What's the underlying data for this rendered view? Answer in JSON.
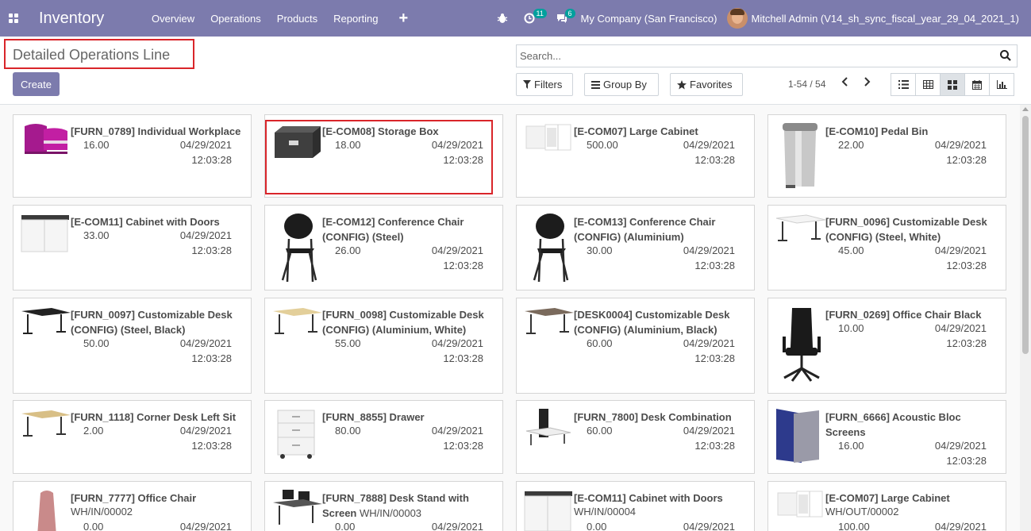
{
  "navbar": {
    "app_title": "Inventory",
    "menu": [
      "Overview",
      "Operations",
      "Products",
      "Reporting"
    ],
    "plus": "+",
    "activity_badge": "11",
    "messages_badge": "6",
    "company": "My Company (San Francisco)",
    "user": "Mitchell Admin (V14_sh_sync_fiscal_year_29_04_2021_1)",
    "bg_color": "#7c7bad"
  },
  "control": {
    "page_title": "Detailed Operations Line",
    "create_label": "Create",
    "search_placeholder": "Search...",
    "filters_label": "Filters",
    "groupby_label": "Group By",
    "favorites_label": "Favorites",
    "pager": "1-54 / 54",
    "active_view": "kanban"
  },
  "cards": [
    {
      "name": "[FURN_0789] Individual Workplace",
      "ref": "",
      "qty": "16.00",
      "date": "04/29/2021",
      "time": "12:03:28",
      "icon": "workplace-image"
    },
    {
      "name": "[E-COM08] Storage Box",
      "ref": "",
      "qty": "18.00",
      "date": "04/29/2021",
      "time": "12:03:28",
      "icon": "storage-box-image"
    },
    {
      "name": "[E-COM07] Large Cabinet",
      "ref": "",
      "qty": "500.00",
      "date": "04/29/2021",
      "time": "12:03:28",
      "icon": "cabinet-image"
    },
    {
      "name": "[E-COM10] Pedal Bin",
      "ref": "",
      "qty": "22.00",
      "date": "04/29/2021",
      "time": "12:03:28",
      "icon": "pedal-bin-image"
    },
    {
      "name": "[E-COM11] Cabinet with Doors",
      "ref": "",
      "qty": "33.00",
      "date": "04/29/2021",
      "time": "12:03:28",
      "icon": "cabinet-doors-image"
    },
    {
      "name": "[E-COM12] Conference Chair (CONFIG) (Steel)",
      "ref": "",
      "qty": "26.00",
      "date": "04/29/2021",
      "time": "12:03:28",
      "icon": "chair-image"
    },
    {
      "name": "[E-COM13] Conference Chair (CONFIG) (Aluminium)",
      "ref": "",
      "qty": "30.00",
      "date": "04/29/2021",
      "time": "12:03:28",
      "icon": "chair-image"
    },
    {
      "name": "[FURN_0096] Customizable Desk (CONFIG) (Steel, White)",
      "ref": "",
      "qty": "45.00",
      "date": "04/29/2021",
      "time": "12:03:28",
      "icon": "desk-white-image"
    },
    {
      "name": "[FURN_0097] Customizable Desk (CONFIG) (Steel, Black)",
      "ref": "",
      "qty": "50.00",
      "date": "04/29/2021",
      "time": "12:03:28",
      "icon": "desk-black-image"
    },
    {
      "name": "[FURN_0098] Customizable Desk (CONFIG) (Aluminium, White)",
      "ref": "",
      "qty": "55.00",
      "date": "04/29/2021",
      "time": "12:03:28",
      "icon": "desk-wood-image"
    },
    {
      "name": "[DESK0004] Customizable Desk (CONFIG) (Aluminium, Black)",
      "ref": "",
      "qty": "60.00",
      "date": "04/29/2021",
      "time": "12:03:28",
      "icon": "desk-dark-image"
    },
    {
      "name": "[FURN_0269] Office Chair Black",
      "ref": "",
      "qty": "10.00",
      "date": "04/29/2021",
      "time": "12:03:28",
      "icon": "office-chair-image"
    },
    {
      "name": "[FURN_1118] Corner Desk Left Sit",
      "ref": "",
      "qty": "2.00",
      "date": "04/29/2021",
      "time": "12:03:28",
      "icon": "corner-desk-image"
    },
    {
      "name": "[FURN_8855] Drawer",
      "ref": "",
      "qty": "80.00",
      "date": "04/29/2021",
      "time": "12:03:28",
      "icon": "drawer-image"
    },
    {
      "name": "[FURN_7800] Desk Combination",
      "ref": "",
      "qty": "60.00",
      "date": "04/29/2021",
      "time": "12:03:28",
      "icon": "desk-combination-image"
    },
    {
      "name": "[FURN_6666] Acoustic Bloc Screens",
      "ref": "",
      "qty": "16.00",
      "date": "04/29/2021",
      "time": "12:03:28",
      "icon": "acoustic-screen-image"
    },
    {
      "name": "[FURN_7777] Office Chair",
      "ref": "WH/IN/00002",
      "qty": "0.00",
      "date": "04/29/2021",
      "time": "",
      "icon": "office-chair-pink-image"
    },
    {
      "name": "[FURN_7888] Desk Stand with Screen",
      "ref": "WH/IN/00003",
      "qty": "0.00",
      "date": "04/29/2021",
      "time": "",
      "icon": "desk-stand-image"
    },
    {
      "name": "[E-COM11] Cabinet with Doors",
      "ref": "WH/IN/00004",
      "qty": "0.00",
      "date": "04/29/2021",
      "time": "",
      "icon": "cabinet-doors-image"
    },
    {
      "name": "[E-COM07] Large Cabinet",
      "ref": "WH/OUT/00002",
      "qty": "100.00",
      "date": "04/29/2021",
      "time": "",
      "icon": "cabinet-image"
    }
  ]
}
